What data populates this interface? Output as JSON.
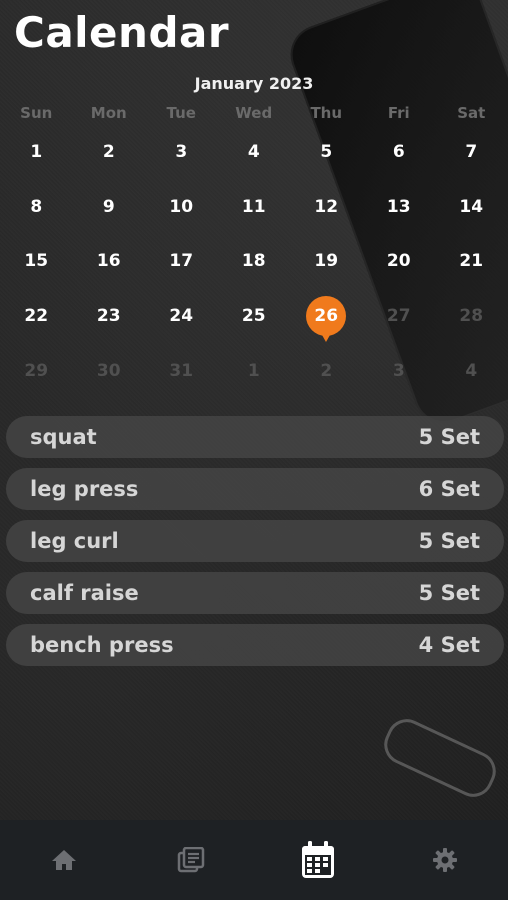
{
  "header": {
    "title": "Calendar"
  },
  "calendar": {
    "month_label": "January 2023",
    "weekdays": [
      "Sun",
      "Mon",
      "Tue",
      "Wed",
      "Thu",
      "Fri",
      "Sat"
    ],
    "weeks": [
      [
        "1",
        "2",
        "3",
        "4",
        "5",
        "6",
        "7"
      ],
      [
        "8",
        "9",
        "10",
        "11",
        "12",
        "13",
        "14"
      ],
      [
        "15",
        "16",
        "17",
        "18",
        "19",
        "20",
        "21"
      ],
      [
        "22",
        "23",
        "24",
        "25",
        "26",
        "27",
        "28"
      ],
      [
        "29",
        "30",
        "31",
        "1",
        "2",
        "3",
        "4"
      ]
    ],
    "selected_day": "26",
    "accent_color": "#f07a1c"
  },
  "workouts": [
    {
      "name": "squat",
      "sets": "5 Set"
    },
    {
      "name": "leg press",
      "sets": "6 Set"
    },
    {
      "name": "leg curl",
      "sets": "5 Set"
    },
    {
      "name": "calf raise",
      "sets": "5 Set"
    },
    {
      "name": "bench press",
      "sets": "4 Set"
    }
  ],
  "bottom_nav": {
    "items": [
      {
        "icon": "home-icon",
        "active": false
      },
      {
        "icon": "notes-icon",
        "active": false
      },
      {
        "icon": "calendar-icon",
        "active": true
      },
      {
        "icon": "settings-icon",
        "active": false
      }
    ]
  }
}
